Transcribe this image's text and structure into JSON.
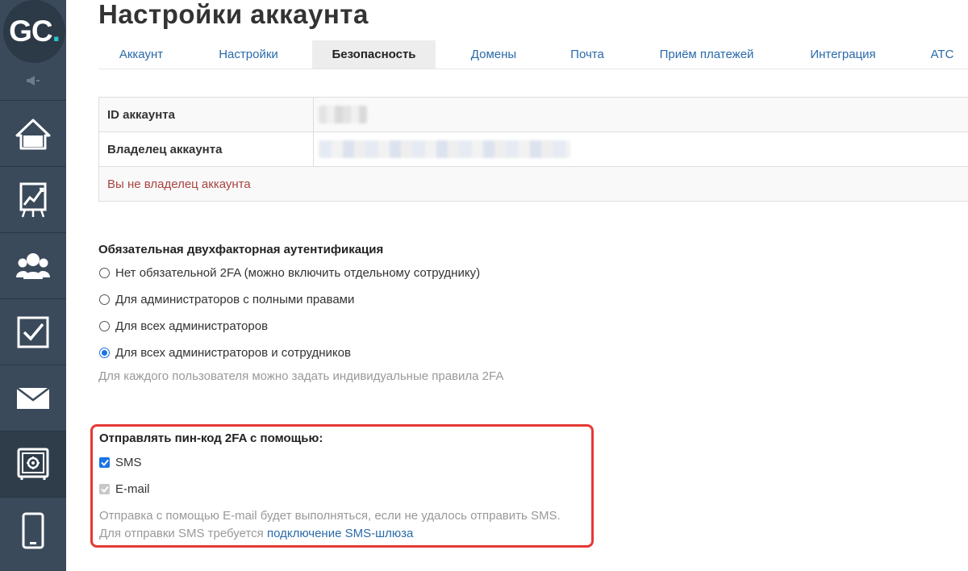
{
  "logo": {
    "text": "GC",
    "dot": "."
  },
  "sidebar": {
    "items": [
      {
        "name": "home-icon"
      },
      {
        "name": "chart-icon"
      },
      {
        "name": "users-icon"
      },
      {
        "name": "checkbox-icon"
      },
      {
        "name": "mail-icon"
      },
      {
        "name": "safe-icon"
      },
      {
        "name": "phone-icon"
      }
    ]
  },
  "page": {
    "title": "Настройки аккаунта"
  },
  "tabs": [
    {
      "label": "Аккаунт"
    },
    {
      "label": "Настройки"
    },
    {
      "label": "Безопасность",
      "active": true
    },
    {
      "label": "Домены"
    },
    {
      "label": "Почта"
    },
    {
      "label": "Приём платежей"
    },
    {
      "label": "Интеграция"
    },
    {
      "label": "АТС"
    }
  ],
  "account_table": {
    "id_label": "ID аккаунта",
    "owner_label": "Владелец аккаунта",
    "warning": "Вы не владелец аккаунта"
  },
  "twofa": {
    "title": "Обязательная двухфакторная аутентификация",
    "options": [
      {
        "label": "Нет обязательной 2FA (можно включить отдельному сотруднику)",
        "checked": false
      },
      {
        "label": "Для администраторов с полными правами",
        "checked": false
      },
      {
        "label": "Для всех администраторов",
        "checked": false
      },
      {
        "label": "Для всех администраторов и сотрудников",
        "checked": true
      }
    ],
    "hint": "Для каждого пользователя можно задать индивидуальные правила 2FA"
  },
  "pin": {
    "title": "Отправлять пин-код 2FA с помощью:",
    "sms_label": "SMS",
    "email_label": "E-mail",
    "note_email": "Отправка с помощью E-mail будет выполняться, если не удалось отправить SMS.",
    "note_sms_prefix": "Для отправки SMS требуется",
    "note_sms_link": "подключение SMS-шлюза"
  },
  "colors": {
    "sidebar": "#3a4a5b",
    "accent": "#1a73e8",
    "link": "#2a6aaa",
    "warning": "#a94442",
    "highlight_border": "#e53935"
  }
}
